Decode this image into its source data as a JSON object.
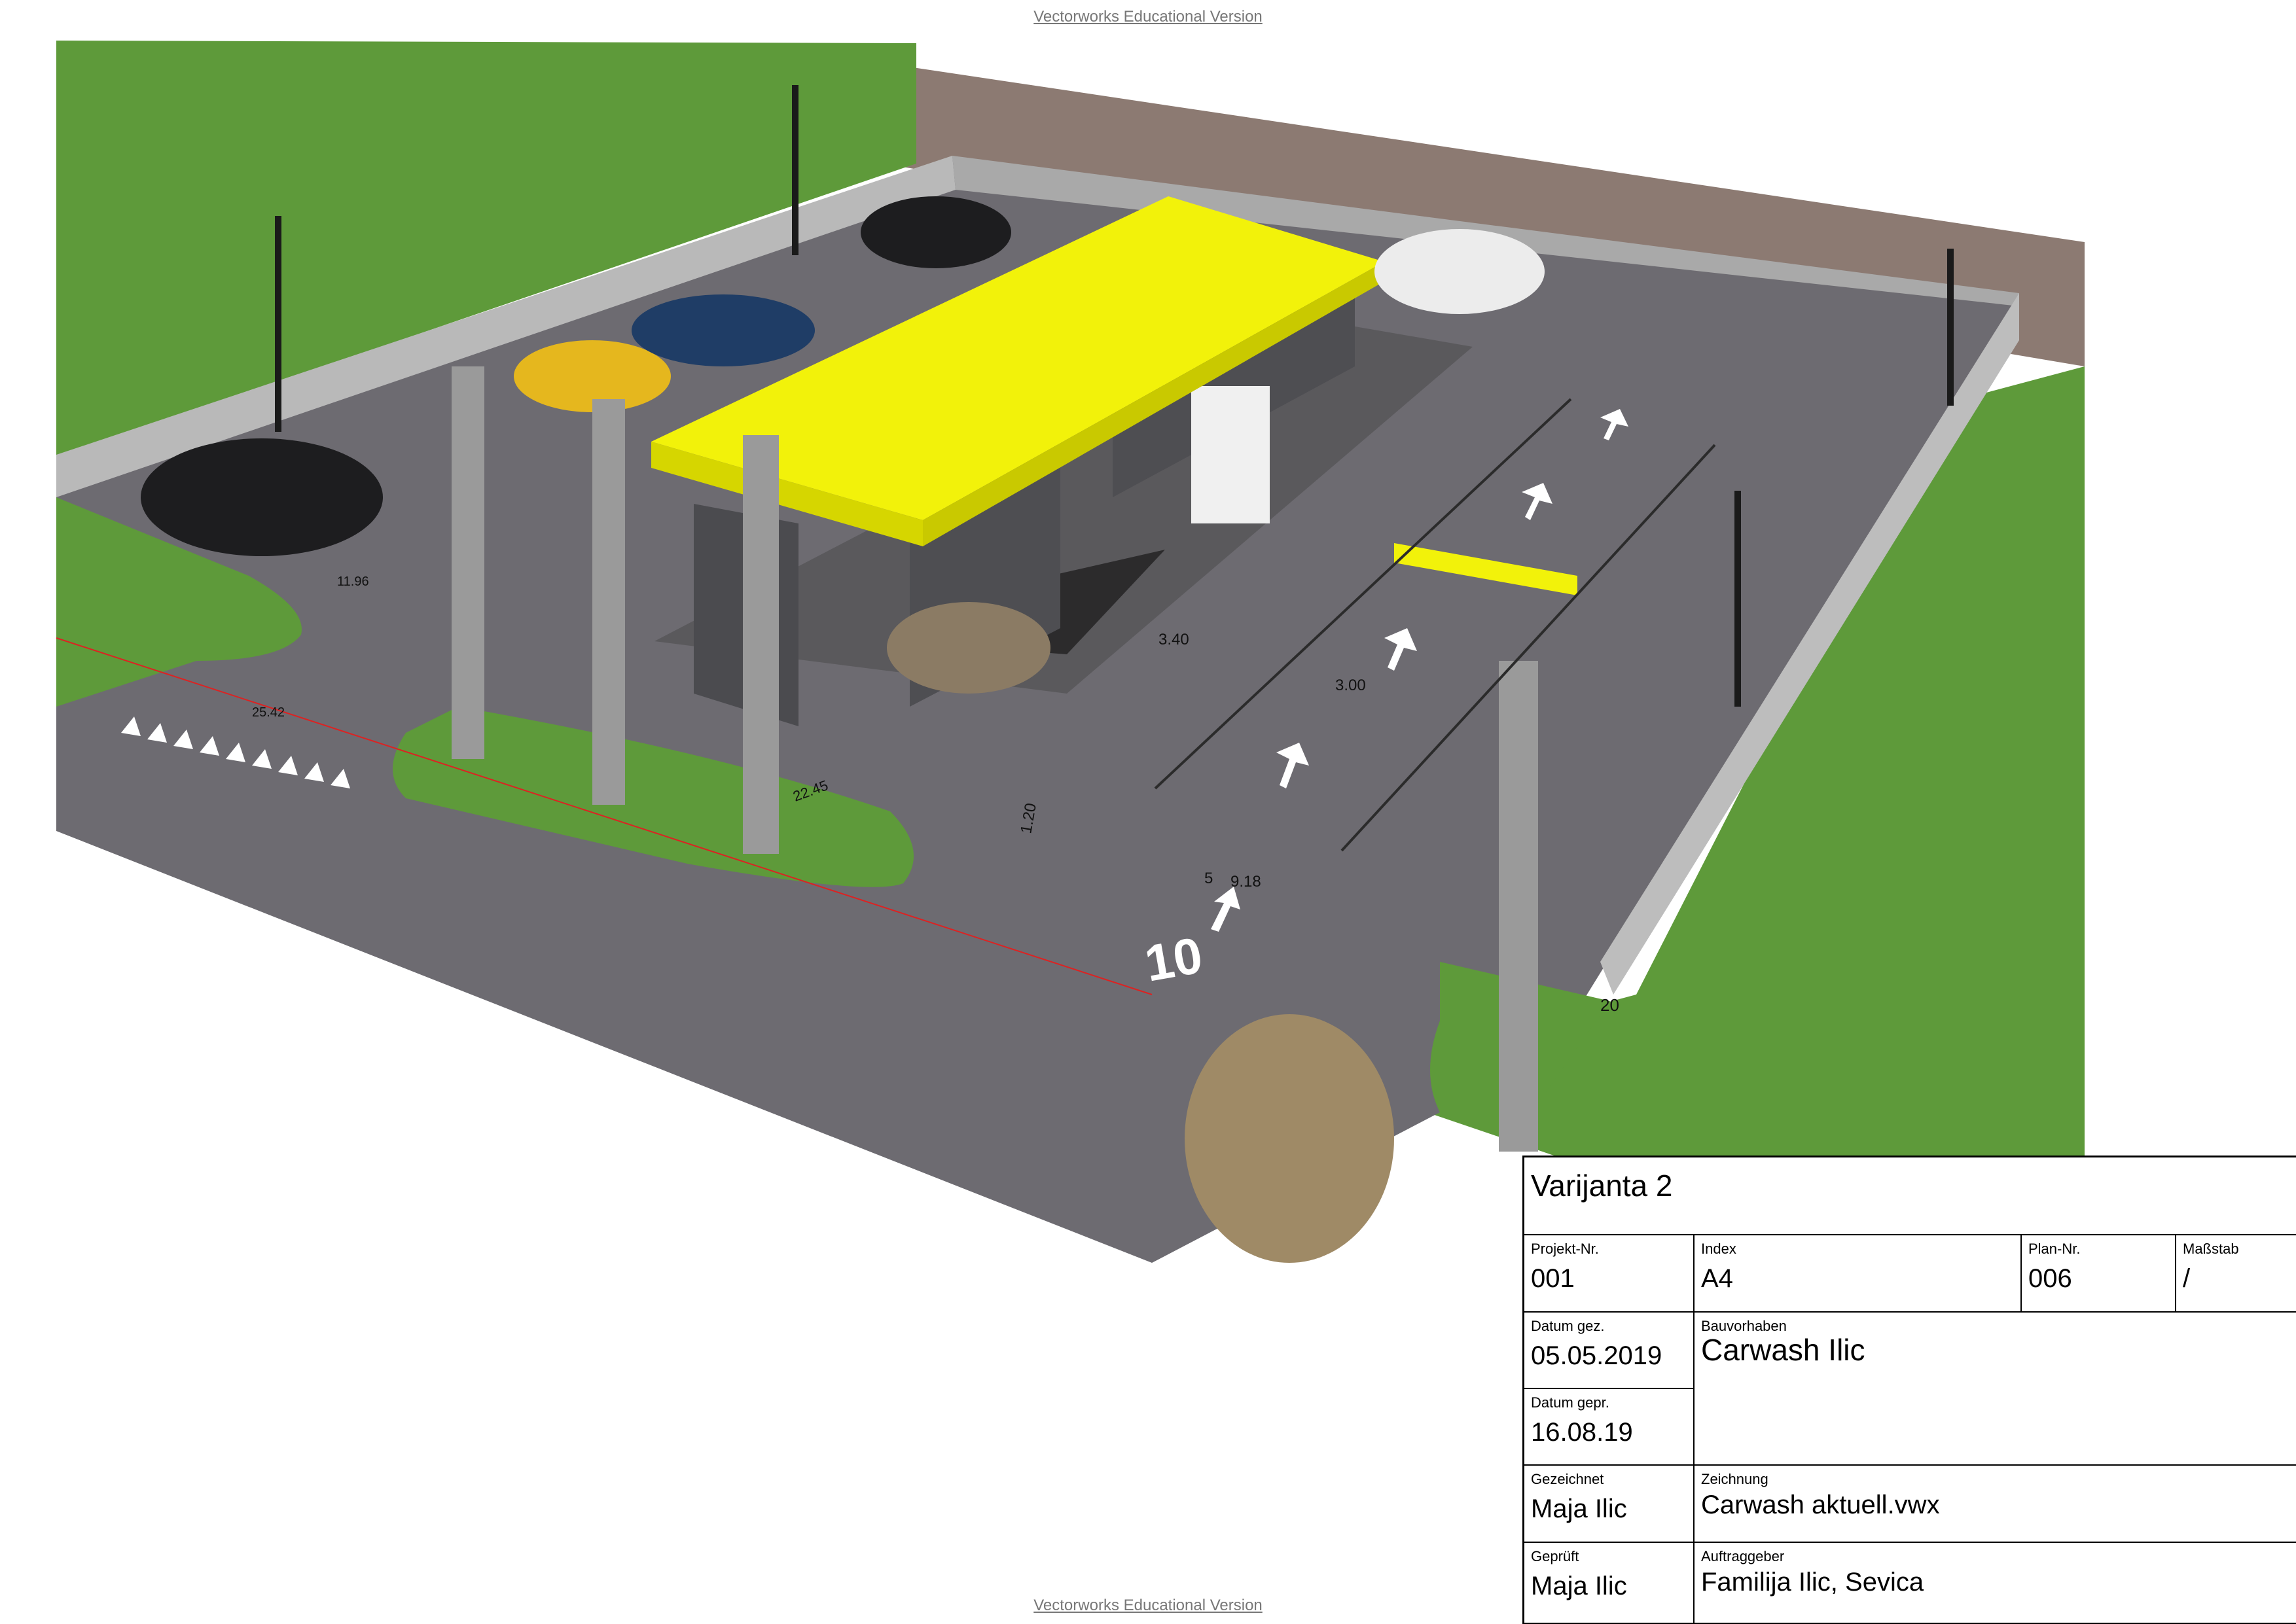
{
  "watermark": "Vectorworks Educational Version",
  "drawing_labels": {
    "road_number": "10",
    "dim_918": "9.18",
    "dim_5": "5",
    "dim_120": "1.20",
    "dim_340": "3.40",
    "dim_300": "3.00",
    "dim_2245": "22.45",
    "dim_20": "20",
    "dim_1196": "11.96",
    "dim_2542": "25.42"
  },
  "title_block": {
    "title": "Varijanta 2",
    "projekt_nr_label": "Projekt-Nr.",
    "projekt_nr": "001",
    "index_label": "Index",
    "index": "A4",
    "plan_nr_label": "Plan-Nr.",
    "plan_nr": "006",
    "massstab_label": "Maßstab",
    "massstab": "/",
    "datum_gez_label": "Datum gez.",
    "datum_gez": "05.05.2019",
    "datum_gepr_label": "Datum gepr.",
    "datum_gepr": "16.08.19",
    "bauvorhaben_label": "Bauvorhaben",
    "bauvorhaben": "Carwash Ilic",
    "gezeichnet_label": "Gezeichnet",
    "gezeichnet": "Maja Ilic",
    "zeichnung_label": "Zeichnung",
    "zeichnung": "Carwash aktuell.vwx",
    "geprueft_label": "Geprüft",
    "geprueft": "Maja Ilic",
    "auftraggeber_label": "Auftraggeber",
    "auftraggeber": "Familija Ilic, Sevica"
  },
  "colors": {
    "grass": "#5e9a3a",
    "asphalt": "#6d6b71",
    "gravel": "#8c7a72",
    "canopy": "#f2f20a",
    "wall": "#b9b9b9",
    "pillar": "#9a9a9a"
  }
}
